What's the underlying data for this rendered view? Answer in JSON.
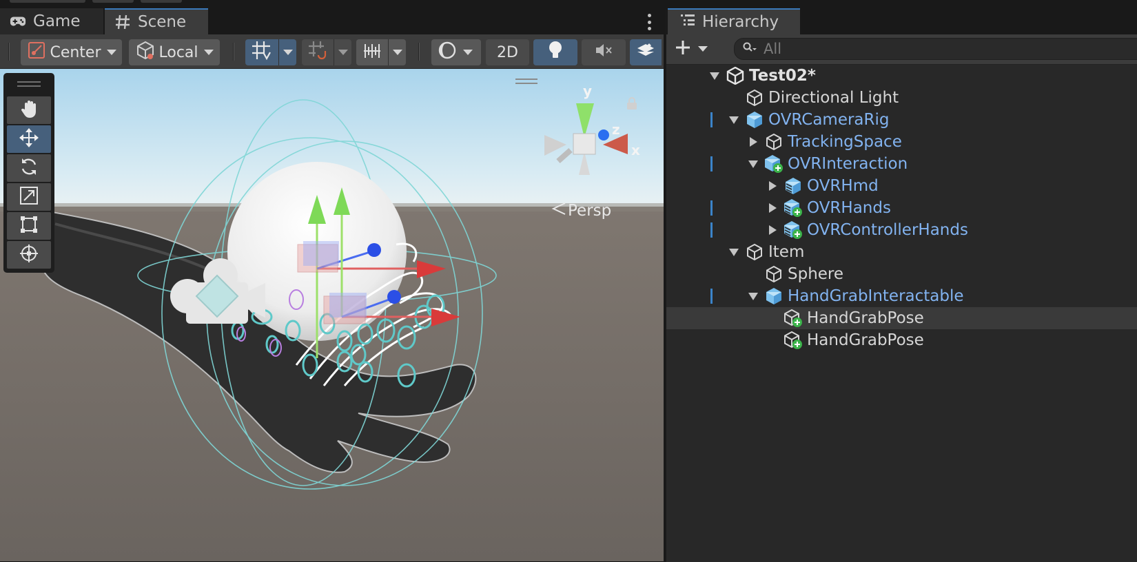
{
  "tabs": {
    "game": "Game",
    "scene": "Scene"
  },
  "toolbar": {
    "pivot_mode": "Center",
    "pivot_rotation": "Local",
    "mode_2d": "2D"
  },
  "scene_view": {
    "projection": "Persp",
    "axis_y": "y",
    "axis_z": "z",
    "axis_x": "x"
  },
  "hierarchy": {
    "tab_label": "Hierarchy",
    "search_placeholder": "All",
    "items": [
      {
        "label": "Test02*",
        "depth": 0,
        "fold": "expanded",
        "icon": "unity-scene-icon",
        "style": "root",
        "mark": false
      },
      {
        "label": "Directional Light",
        "depth": 1,
        "fold": "none",
        "icon": "gameobject-icon",
        "style": "normal",
        "mark": false
      },
      {
        "label": "OVRCameraRig",
        "depth": 1,
        "fold": "expanded",
        "icon": "prefab-icon",
        "style": "prefab",
        "mark": true
      },
      {
        "label": "TrackingSpace",
        "depth": 2,
        "fold": "collapsed",
        "icon": "gameobject-icon",
        "style": "prefab",
        "mark": false
      },
      {
        "label": "OVRInteraction",
        "depth": 2,
        "fold": "expanded",
        "icon": "prefab-added-icon",
        "style": "prefab",
        "mark": true
      },
      {
        "label": "OVRHmd",
        "depth": 3,
        "fold": "collapsed",
        "icon": "prefab-variant-icon",
        "style": "prefab",
        "mark": false
      },
      {
        "label": "OVRHands",
        "depth": 3,
        "fold": "collapsed",
        "icon": "prefab-variant-added-icon",
        "style": "prefab",
        "mark": true
      },
      {
        "label": "OVRControllerHands",
        "depth": 3,
        "fold": "collapsed",
        "icon": "prefab-variant-added-icon",
        "style": "prefab",
        "mark": true
      },
      {
        "label": "Item",
        "depth": 1,
        "fold": "expanded",
        "icon": "gameobject-icon",
        "style": "normal",
        "mark": false
      },
      {
        "label": "Sphere",
        "depth": 2,
        "fold": "none",
        "icon": "gameobject-icon",
        "style": "normal",
        "mark": false
      },
      {
        "label": "HandGrabInteractable",
        "depth": 2,
        "fold": "expanded",
        "icon": "prefab-icon",
        "style": "prefab",
        "mark": true
      },
      {
        "label": "HandGrabPose",
        "depth": 3,
        "fold": "none",
        "icon": "gameobject-added-icon",
        "style": "normal",
        "mark": false,
        "selected": true
      },
      {
        "label": "HandGrabPose",
        "depth": 3,
        "fold": "none",
        "icon": "gameobject-added-icon",
        "style": "normal",
        "mark": false
      }
    ]
  },
  "colors": {
    "accent": "#3a79bb",
    "prefab_text": "#82b3f0",
    "panel_bg": "#282828",
    "toolbar_bg": "#3c3c3c",
    "sky": "#b9dcef",
    "ground": "#6b6560"
  }
}
